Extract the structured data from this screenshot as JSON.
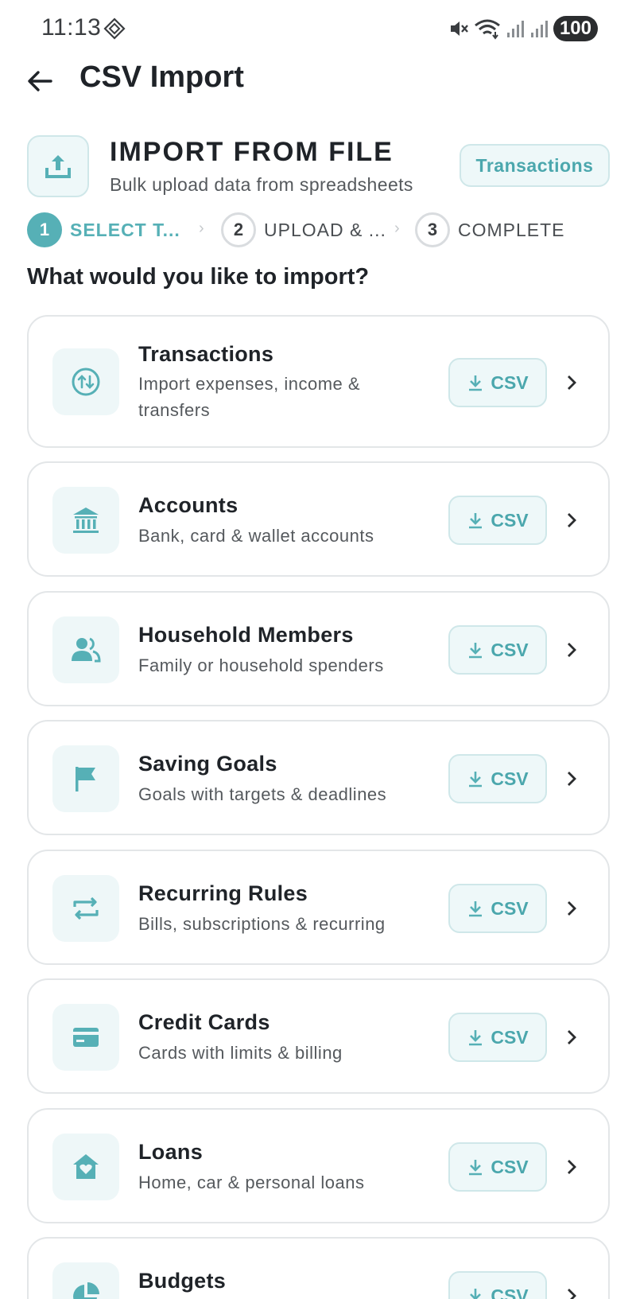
{
  "status": {
    "time": "11:13",
    "battery": "100"
  },
  "app_bar": {
    "title": "CSV Import"
  },
  "header": {
    "title": "IMPORT FROM FILE",
    "subtitle": "Bulk upload data from spreadsheets",
    "chip": "Transactions"
  },
  "stepper": {
    "steps": [
      {
        "number": "1",
        "label": "SELECT T...",
        "state": "active"
      },
      {
        "number": "2",
        "label": "UPLOAD & ...",
        "state": "idle"
      },
      {
        "number": "3",
        "label": "COMPLETE",
        "state": "idle"
      }
    ]
  },
  "question": "What would you like to import?",
  "csv_label": "CSV",
  "items": [
    {
      "title": "Transactions",
      "desc": "Import expenses, income & transfers",
      "icon": "transfer-icon"
    },
    {
      "title": "Accounts",
      "desc": "Bank, card & wallet accounts",
      "icon": "bank-icon"
    },
    {
      "title": "Household Members",
      "desc": "Family or household spenders",
      "icon": "people-icon"
    },
    {
      "title": "Saving Goals",
      "desc": "Goals with targets & deadlines",
      "icon": "flag-icon"
    },
    {
      "title": "Recurring Rules",
      "desc": "Bills, subscriptions & recurring",
      "icon": "repeat-icon"
    },
    {
      "title": "Credit Cards",
      "desc": "Cards with limits & billing",
      "icon": "credit-card-icon"
    },
    {
      "title": "Loans",
      "desc": "Home, car & personal loans",
      "icon": "home-heart-icon"
    },
    {
      "title": "Budgets",
      "desc": "",
      "icon": "pie-chart-icon"
    }
  ],
  "colors": {
    "accent": "#56b0b6",
    "accent_light": "#eef8f9",
    "border": "#e3e6e8"
  }
}
